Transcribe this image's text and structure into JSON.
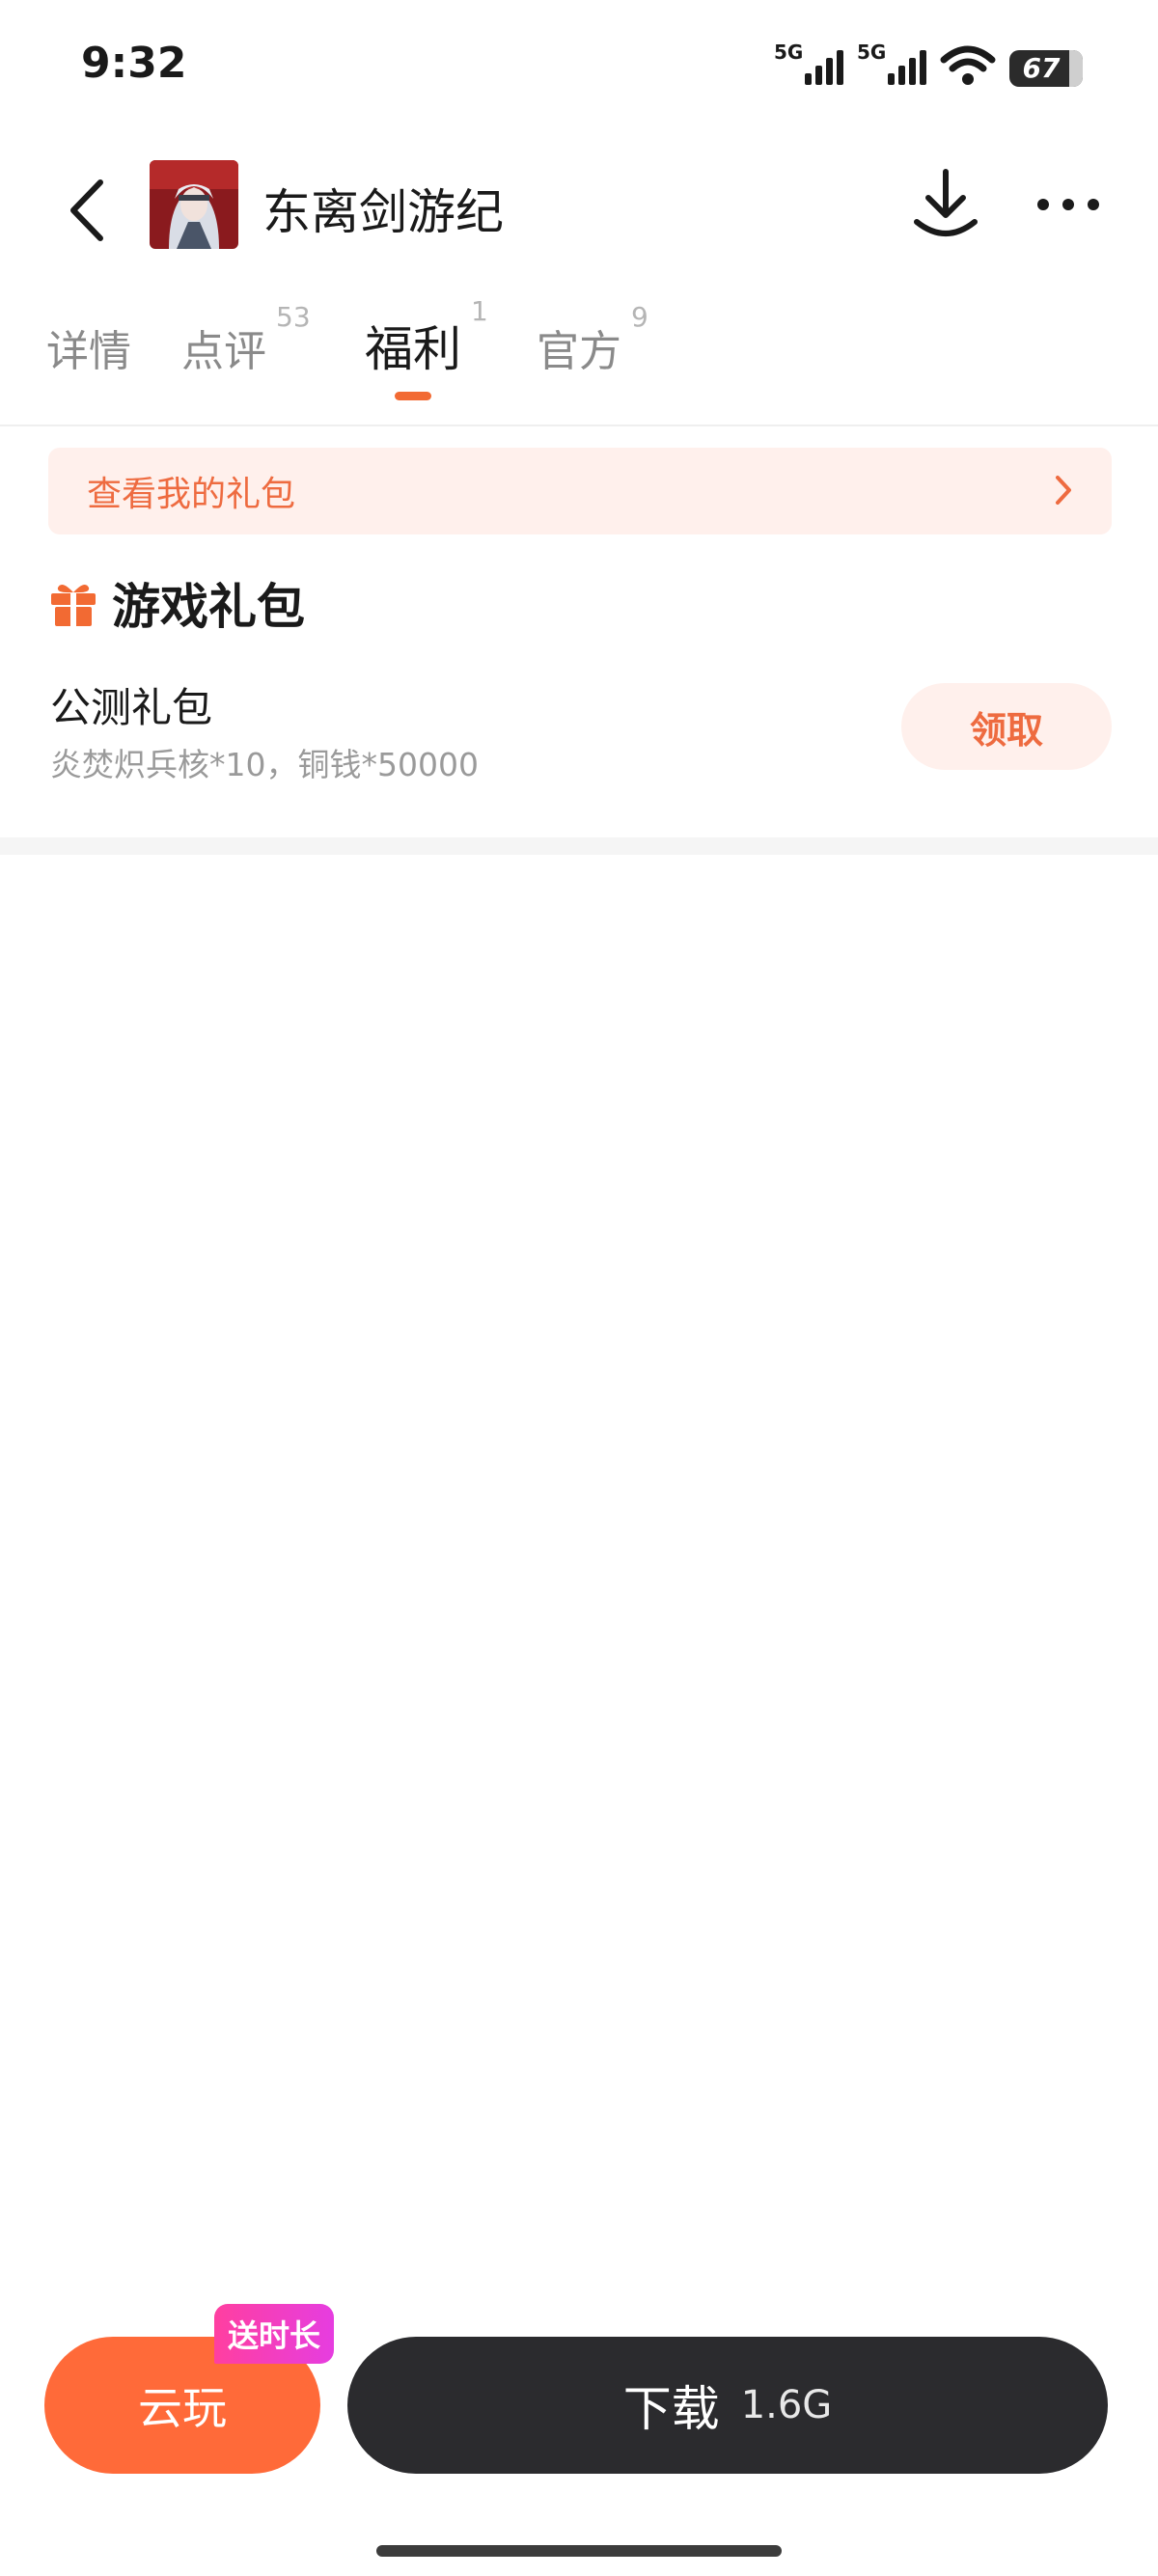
{
  "status_bar": {
    "time": "9:32",
    "signal1_label": "5G",
    "signal2_label": "5G",
    "battery_level": "67",
    "icons": [
      "signal-5g-icon",
      "signal-5g-icon",
      "wifi-icon",
      "battery-icon"
    ]
  },
  "header": {
    "app_title": "东离剑游纪",
    "icons": [
      "back-icon",
      "app-avatar",
      "download-icon",
      "more-icon"
    ]
  },
  "tabs": [
    {
      "label": "详情",
      "badge": ""
    },
    {
      "label": "点评",
      "badge": "53"
    },
    {
      "label": "福利",
      "badge": "1",
      "active": true
    },
    {
      "label": "官方",
      "badge": "9"
    }
  ],
  "my_gifts_banner": {
    "label": "查看我的礼包"
  },
  "gift_section": {
    "title": "游戏礼包",
    "items": [
      {
        "name": "公测礼包",
        "desc": "炎焚炽兵核*10，铜钱*50000",
        "action": "领取"
      }
    ]
  },
  "bottom_bar": {
    "cloud_play_label": "云玩",
    "cloud_play_tag": "送时长",
    "download_label": "下载",
    "download_size": "1.6G"
  },
  "colors": {
    "accent": "#f26a33",
    "accent_light_bg": "#fff0ec",
    "cloud_button": "#ff6a39",
    "download_button": "#2b2b2e",
    "tag_pink": "#ff3fa0"
  }
}
